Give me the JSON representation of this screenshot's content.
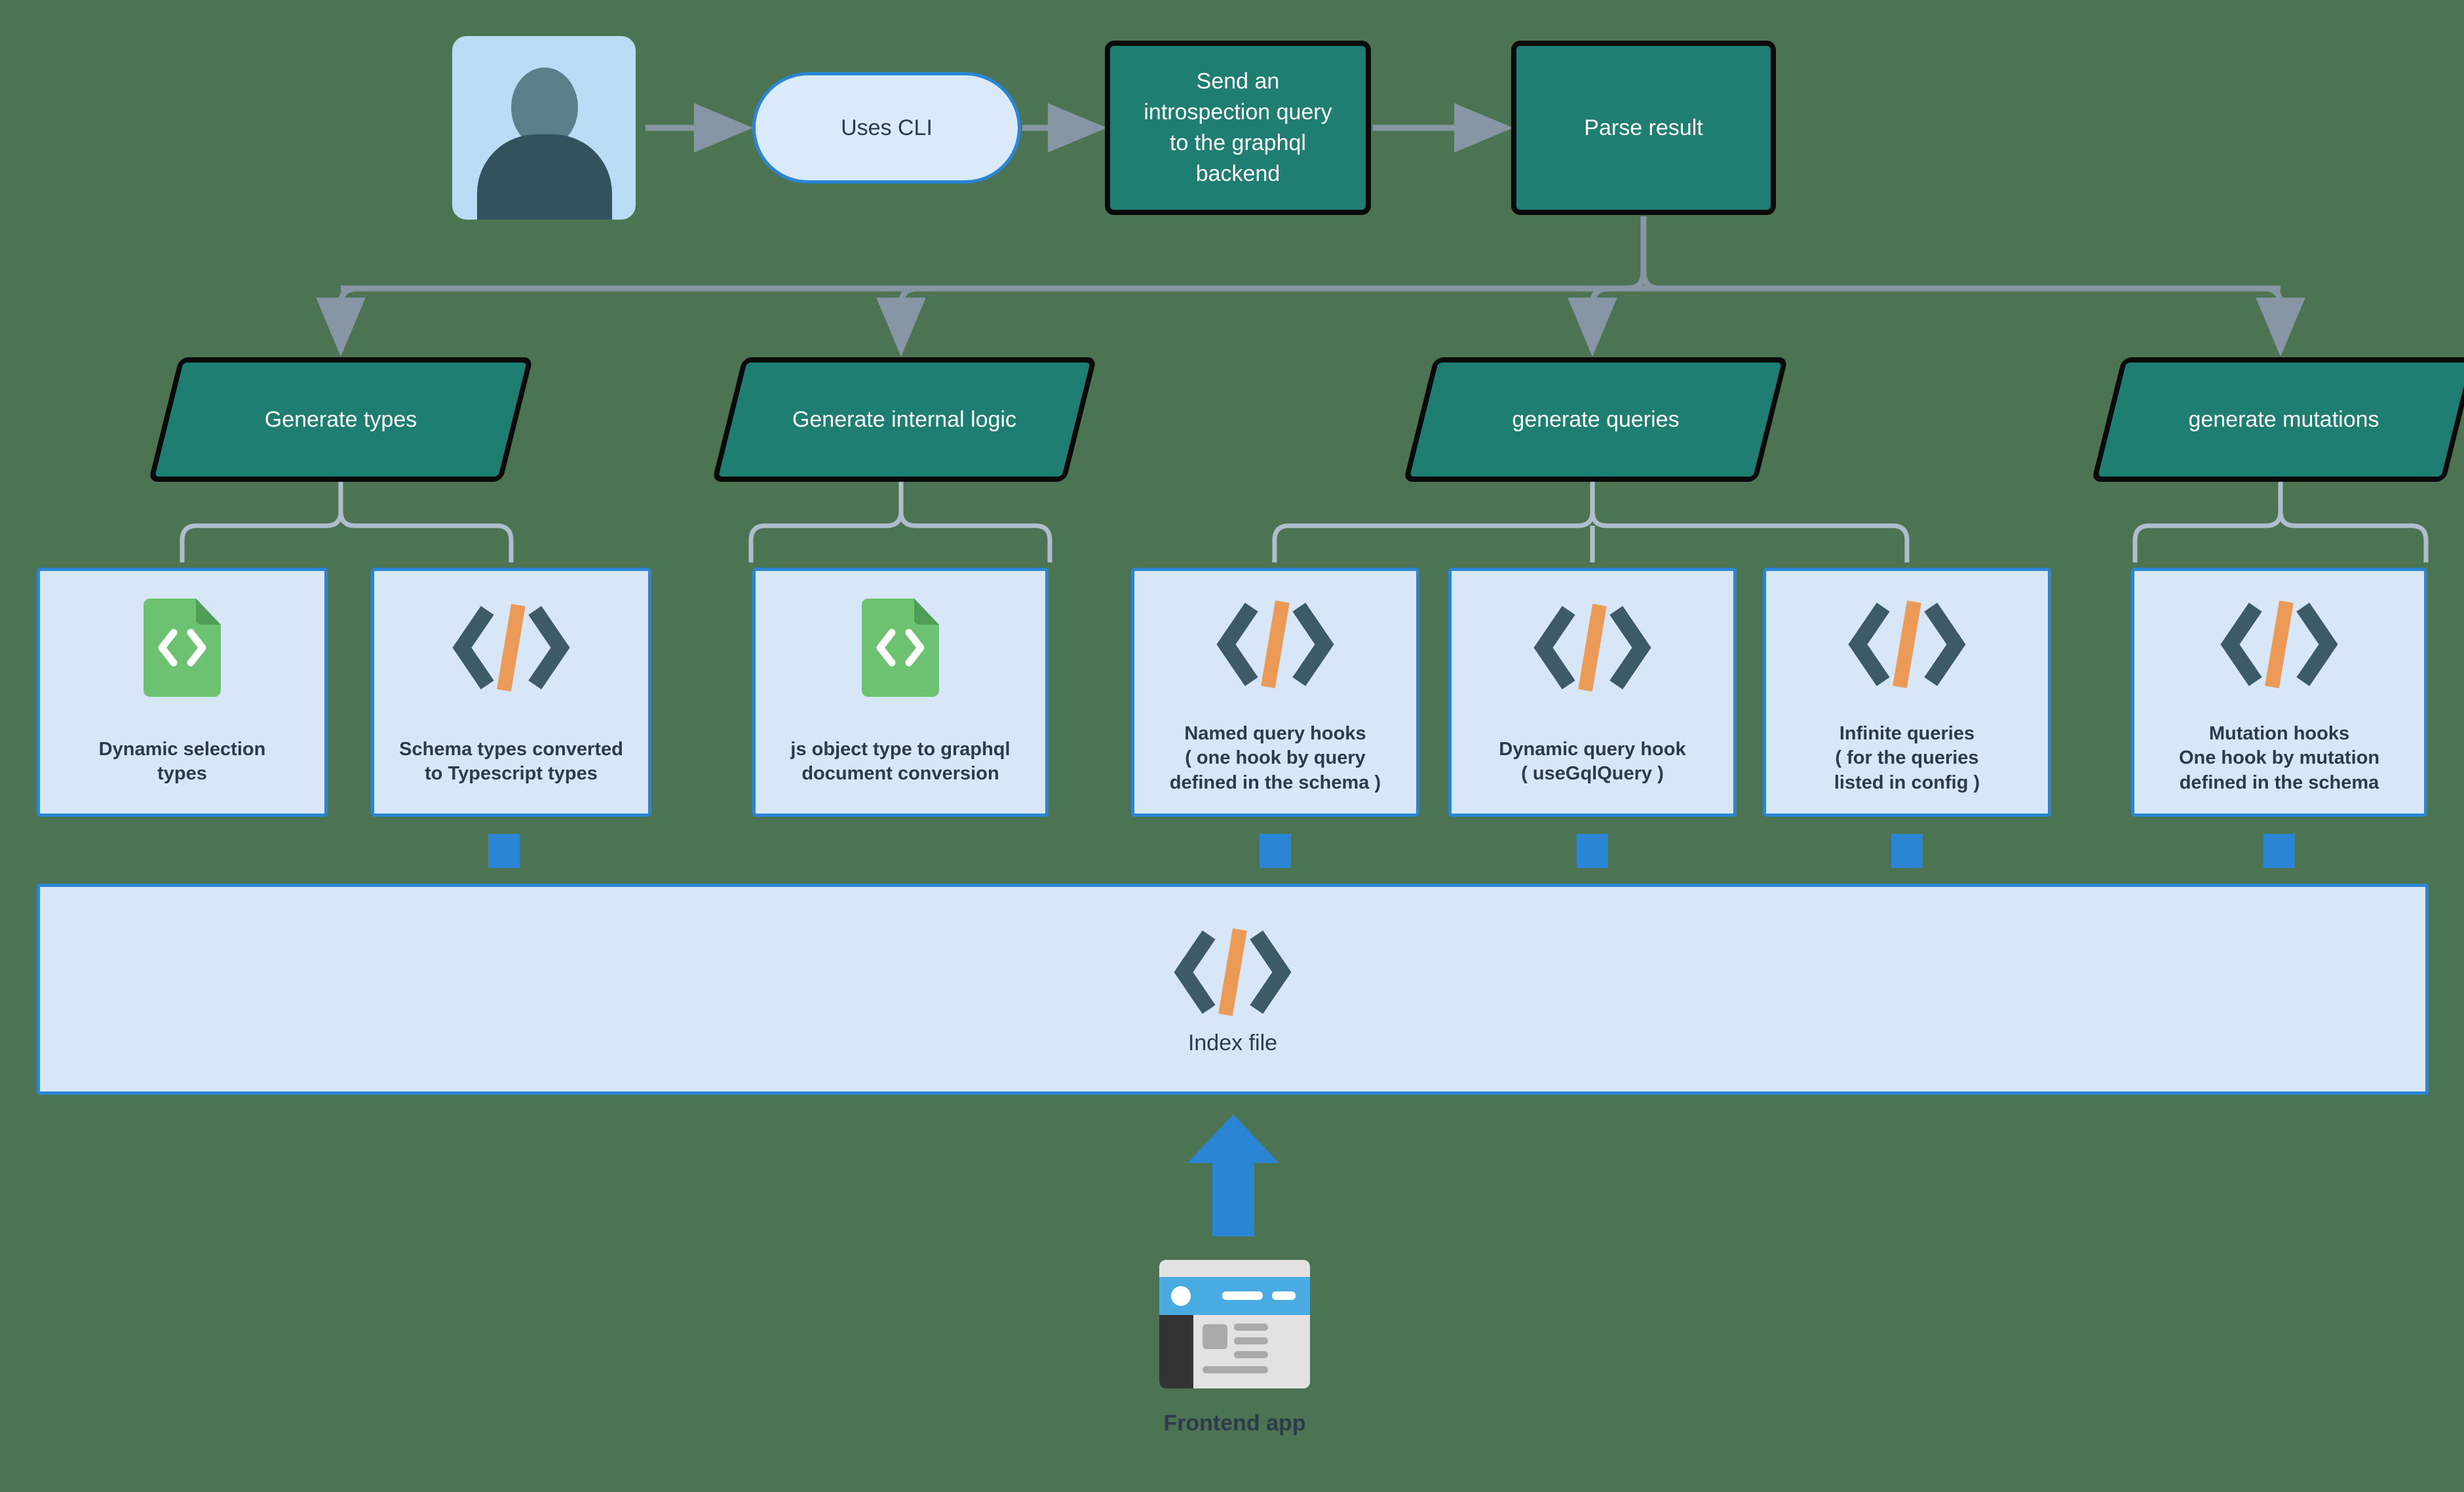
{
  "background_color": "#4c7453",
  "palette": {
    "teal": "#1d7e71",
    "card_fill": "#d8e7f8",
    "card_border": "#2a86d4",
    "edge_gray": "#8796a5",
    "bracket_gray": "#aebecd",
    "text_dark": "#2b3b49",
    "code_slash_orange": "#eb9b57",
    "code_chevron_slate": "#3c5a68",
    "file_green": "#6cc271",
    "file_green_fold": "#4f9e56"
  },
  "actor": {
    "icon": "user-avatar-icon",
    "label": ""
  },
  "flow_top": [
    {
      "id": "uses-cli",
      "shape": "stadium",
      "label": "Uses CLI"
    },
    {
      "id": "introspection",
      "shape": "process",
      "label": "Send an\nintrospection query\nto the graphql\nbackend"
    },
    {
      "id": "parse-result",
      "shape": "process",
      "label": "Parse result"
    }
  ],
  "stages": [
    {
      "id": "generate-types",
      "label": "Generate types"
    },
    {
      "id": "generate-internal-logic",
      "label": "Generate internal logic"
    },
    {
      "id": "generate-queries",
      "label": "generate queries"
    },
    {
      "id": "generate-mutations",
      "label": "generate mutations"
    }
  ],
  "outputs": [
    {
      "id": "dynamic-selection-types",
      "icon": "code-file-icon",
      "label": "Dynamic selection\ntypes",
      "parent": "generate-types"
    },
    {
      "id": "schema-types-converted",
      "icon": "code-tag-icon",
      "label": "Schema types converted\nto Typescript types",
      "parent": "generate-types"
    },
    {
      "id": "js-object-to-graphql",
      "icon": "code-file-icon",
      "label": "js object type to graphql\ndocument conversion",
      "parent": "generate-internal-logic"
    },
    {
      "id": "named-query-hooks",
      "icon": "code-tag-icon",
      "label": "Named query hooks\n( one hook by query\ndefined in the schema )",
      "parent": "generate-queries"
    },
    {
      "id": "dynamic-query-hook",
      "icon": "code-tag-icon",
      "label": "Dynamic query hook\n( useGqlQuery )",
      "parent": "generate-queries"
    },
    {
      "id": "infinite-queries",
      "icon": "code-tag-icon",
      "label": "Infinite queries\n( for the queries\nlisted in config )",
      "parent": "generate-queries"
    },
    {
      "id": "mutation-hooks",
      "icon": "code-tag-icon",
      "label": "Mutation hooks\nOne hook by mutation\ndefined in the schema",
      "parent": "generate-mutations"
    }
  ],
  "index_file": {
    "id": "index-file",
    "icon": "code-tag-icon",
    "label": "Index file"
  },
  "frontend": {
    "id": "frontend-app",
    "icon": "browser-window-icon",
    "arrow_icon": "arrow-up-icon",
    "label": "Frontend app"
  }
}
